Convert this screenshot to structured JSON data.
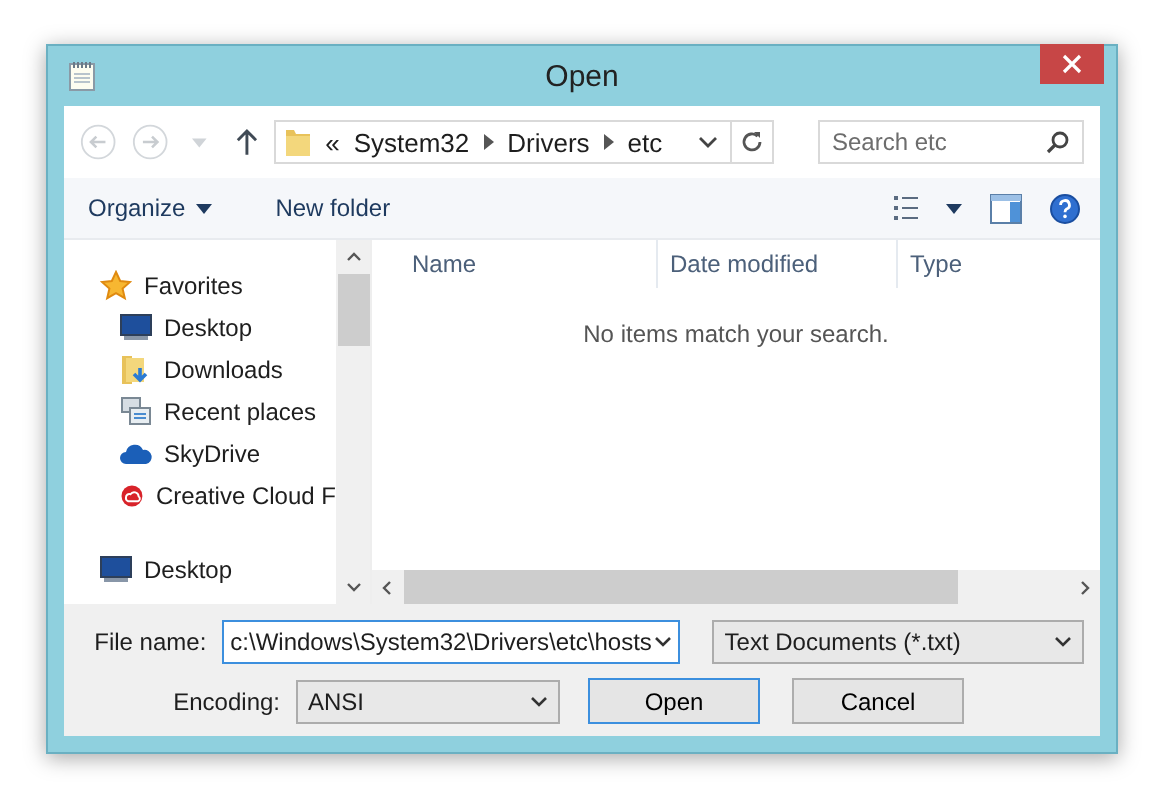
{
  "window": {
    "title": "Open"
  },
  "address": {
    "overflow": "«",
    "crumbs": [
      "System32",
      "Drivers",
      "etc"
    ],
    "search_placeholder": "Search etc"
  },
  "toolbar": {
    "organize": "Organize",
    "new_folder": "New folder"
  },
  "sidebar": {
    "items": [
      {
        "label": "Favorites",
        "kind": "star",
        "children": [
          {
            "label": "Desktop",
            "kind": "desktop"
          },
          {
            "label": "Downloads",
            "kind": "downloads"
          },
          {
            "label": "Recent places",
            "kind": "recent"
          },
          {
            "label": "SkyDrive",
            "kind": "cloud"
          },
          {
            "label": "Creative Cloud F",
            "kind": "creative"
          }
        ]
      },
      {
        "label": "Desktop",
        "kind": "desktop"
      }
    ]
  },
  "file_list": {
    "columns": [
      "Name",
      "Date modified",
      "Type"
    ],
    "empty_message": "No items match your search."
  },
  "bottom": {
    "file_name_label": "File name:",
    "file_name": "c:\\Windows\\System32\\Drivers\\etc\\hosts",
    "file_type": "Text Documents (*.txt)",
    "encoding_label": "Encoding:",
    "encoding": "ANSI",
    "buttons": [
      {
        "label": "Open",
        "default": true
      },
      {
        "label": "Cancel",
        "default": false
      }
    ]
  }
}
